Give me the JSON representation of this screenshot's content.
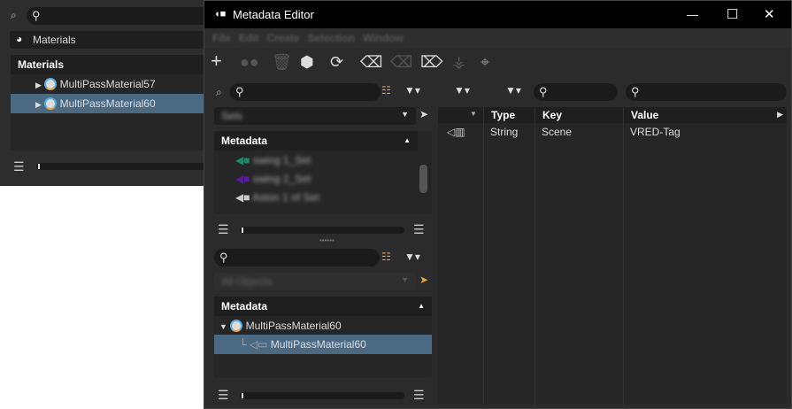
{
  "bg_window": {
    "panel_label": "Materials",
    "header": "Materials",
    "items": [
      "MultiPassMaterial57",
      "MultiPassMaterial60"
    ],
    "selected_index": 1
  },
  "editor": {
    "title": "Metadata Editor",
    "menu": [
      "File",
      "Edit",
      "Create",
      "Selection",
      "Window"
    ],
    "toolbar": [
      "add-icon",
      "link-icon",
      "delete-icon",
      "select-objects-icon",
      "refresh-icon",
      "tag-remove-icon",
      "tag-clear-icon",
      "tag-outline-remove-icon",
      "brush-icon",
      "target-icon"
    ],
    "sets_panel": {
      "combo": "Sets",
      "header": "Metadata",
      "items": [
        "swing 1_Set",
        "swing 2_Set",
        "Aston 1 of Set"
      ],
      "item_colors": [
        "#1a8a6a",
        "#5a1a9a",
        "#cccccc"
      ]
    },
    "objects_panel": {
      "combo": "All Objects",
      "header": "Metadata",
      "parent": "MultiPassMaterial60",
      "child": "MultiPassMaterial60"
    },
    "table": {
      "columns": [
        "Type",
        "Key",
        "Value"
      ],
      "rows": [
        {
          "type": "String",
          "key": "Scene",
          "value": "VRED-Tag"
        }
      ]
    }
  }
}
